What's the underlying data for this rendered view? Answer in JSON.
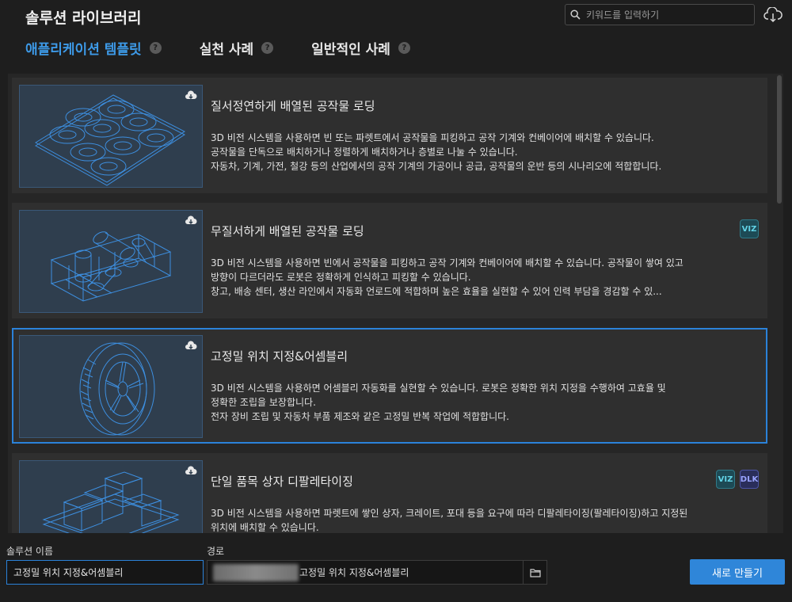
{
  "app": {
    "title": "솔루션 라이브러리"
  },
  "search": {
    "placeholder": "키워드를 입력하기",
    "value": ""
  },
  "header": {
    "cloud_icon": "cloud-download-icon",
    "search_icon": "search-icon"
  },
  "tabs": [
    {
      "label": "애플리케이션 템플릿",
      "active": true
    },
    {
      "label": "실천 사례",
      "active": false
    },
    {
      "label": "일반적인 사례",
      "active": false
    }
  ],
  "help_glyph": "?",
  "cards": [
    {
      "title": "질서정연하게 배열된 공작물 로딩",
      "lines": [
        "3D 비전 시스템을 사용하면 빈 또는 파렛트에서 공작물을 피킹하고 공작 기계와 컨베이어에 배치할 수 있습니다.",
        "공작물을 단독으로 배치하거나 정렬하게 배치하거나 층별로 나눌 수 있습니다.",
        "자동차, 기계, 가전, 철강 등의 산업에서의 공작 기계의 가공이나 공급, 공작물의 운반 등의 시나리오에 적합합니다."
      ],
      "badges": [],
      "thumbnail": "stacked-rings"
    },
    {
      "title": "무질서하게 배열된 공작물 로딩",
      "lines": [
        "3D 비전 시스템을 사용하면 빈에서 공작물을 피킹하고 공작 기계와 컨베이어에 배치할 수 있습니다. 공작물이 쌓여 있고",
        "방향이 다르더라도 로봇은 정확하게 인식하고 피킹할 수 있습니다.",
        "창고, 배송 센터, 생산 라인에서 자동화 언로드에 적합하며 높은 효율을 실현할 수 있어 인력 부담을 경감할 수 있..."
      ],
      "badges": [
        "VIZ"
      ],
      "thumbnail": "cylinders-in-bin"
    },
    {
      "title": "고정밀 위치 지정&어셈블리",
      "lines": [
        "3D 비전 시스템을 사용하면 어셈블리 자동화를 실현할 수 있습니다. 로봇은 정확한 위치 지정을 수행하여 고효율 및",
        "정확한 조립을 보장합니다.",
        "전자 장비 조립 및 자동차 부품 제조와 같은 고정밀 반복 작업에 적합합니다."
      ],
      "badges": [],
      "thumbnail": "tire",
      "selected": true
    },
    {
      "title": "단일 품목 상자 디팔레타이징",
      "lines": [
        "3D 비전 시스템을 사용하면 파렛트에 쌓인 상자, 크레이트, 포대 등을 요구에 따라 디팔레타이징(팔레타이징)하고 지정된",
        "위치에 배치할 수 있습니다."
      ],
      "badges": [
        "VIZ",
        "DLK"
      ],
      "thumbnail": "boxes-on-pallet"
    }
  ],
  "footer": {
    "name_label": "솔루션 이름",
    "name_value": "고정밀 위치 지정&어셈블리",
    "path_label": "경로",
    "path_value": "고정밀 위치 지정&어셈블리",
    "create_label": "새로 만들기",
    "folder_icon": "folder-icon"
  },
  "colors": {
    "accent": "#2f86d9",
    "tab_active": "#3d9ae8",
    "line_art": "#3d8fe0"
  }
}
